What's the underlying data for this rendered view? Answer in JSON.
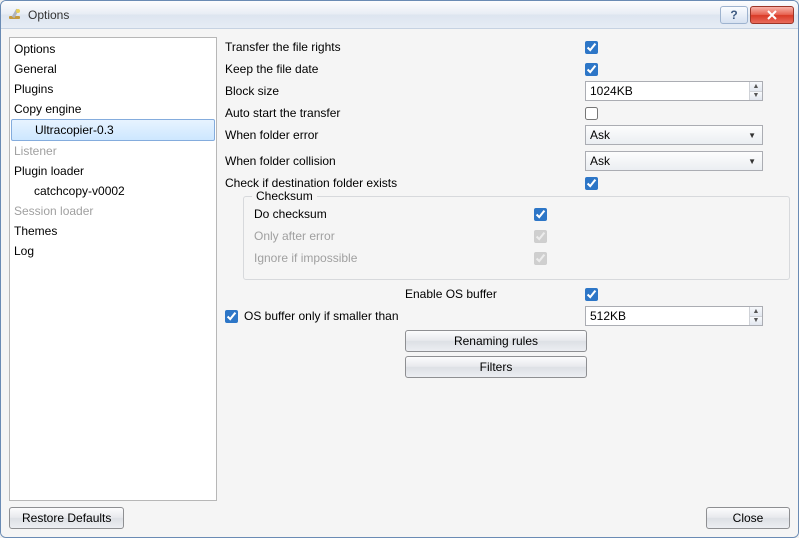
{
  "window": {
    "title": "Options"
  },
  "sidebar": {
    "items": [
      {
        "label": "Options",
        "child": false,
        "disabled": false,
        "selected": false
      },
      {
        "label": "General",
        "child": false,
        "disabled": false,
        "selected": false
      },
      {
        "label": "Plugins",
        "child": false,
        "disabled": false,
        "selected": false
      },
      {
        "label": "Copy engine",
        "child": false,
        "disabled": false,
        "selected": false
      },
      {
        "label": "Ultracopier-0.3",
        "child": true,
        "disabled": false,
        "selected": true
      },
      {
        "label": "Listener",
        "child": false,
        "disabled": true,
        "selected": false
      },
      {
        "label": "Plugin loader",
        "child": false,
        "disabled": false,
        "selected": false
      },
      {
        "label": "catchcopy-v0002",
        "child": true,
        "disabled": false,
        "selected": false
      },
      {
        "label": "Session loader",
        "child": false,
        "disabled": true,
        "selected": false
      },
      {
        "label": "Themes",
        "child": false,
        "disabled": false,
        "selected": false
      },
      {
        "label": "Log",
        "child": false,
        "disabled": false,
        "selected": false
      }
    ]
  },
  "settings": {
    "transfer_rights_label": "Transfer the file rights",
    "transfer_rights_checked": true,
    "keep_date_label": "Keep the file date",
    "keep_date_checked": true,
    "block_size_label": "Block size",
    "block_size_value": "1024KB",
    "auto_start_label": "Auto start the transfer",
    "auto_start_checked": false,
    "folder_error_label": "When folder error",
    "folder_error_value": "Ask",
    "folder_collision_label": "When folder collision",
    "folder_collision_value": "Ask",
    "check_dest_label": "Check if destination folder exists",
    "check_dest_checked": true,
    "checksum_legend": "Checksum",
    "do_checksum_label": "Do checksum",
    "do_checksum_checked": true,
    "only_after_error_label": "Only after error",
    "only_after_error_checked": true,
    "ignore_if_impossible_label": "Ignore if impossible",
    "ignore_if_impossible_checked": true,
    "enable_os_buffer_label": "Enable OS buffer",
    "enable_os_buffer_checked": true,
    "os_buffer_smaller_label": "OS buffer only if smaller than",
    "os_buffer_smaller_checked": true,
    "os_buffer_value": "512KB",
    "renaming_rules_label": "Renaming rules",
    "filters_label": "Filters"
  },
  "buttons": {
    "restore_defaults": "Restore Defaults",
    "close": "Close"
  }
}
